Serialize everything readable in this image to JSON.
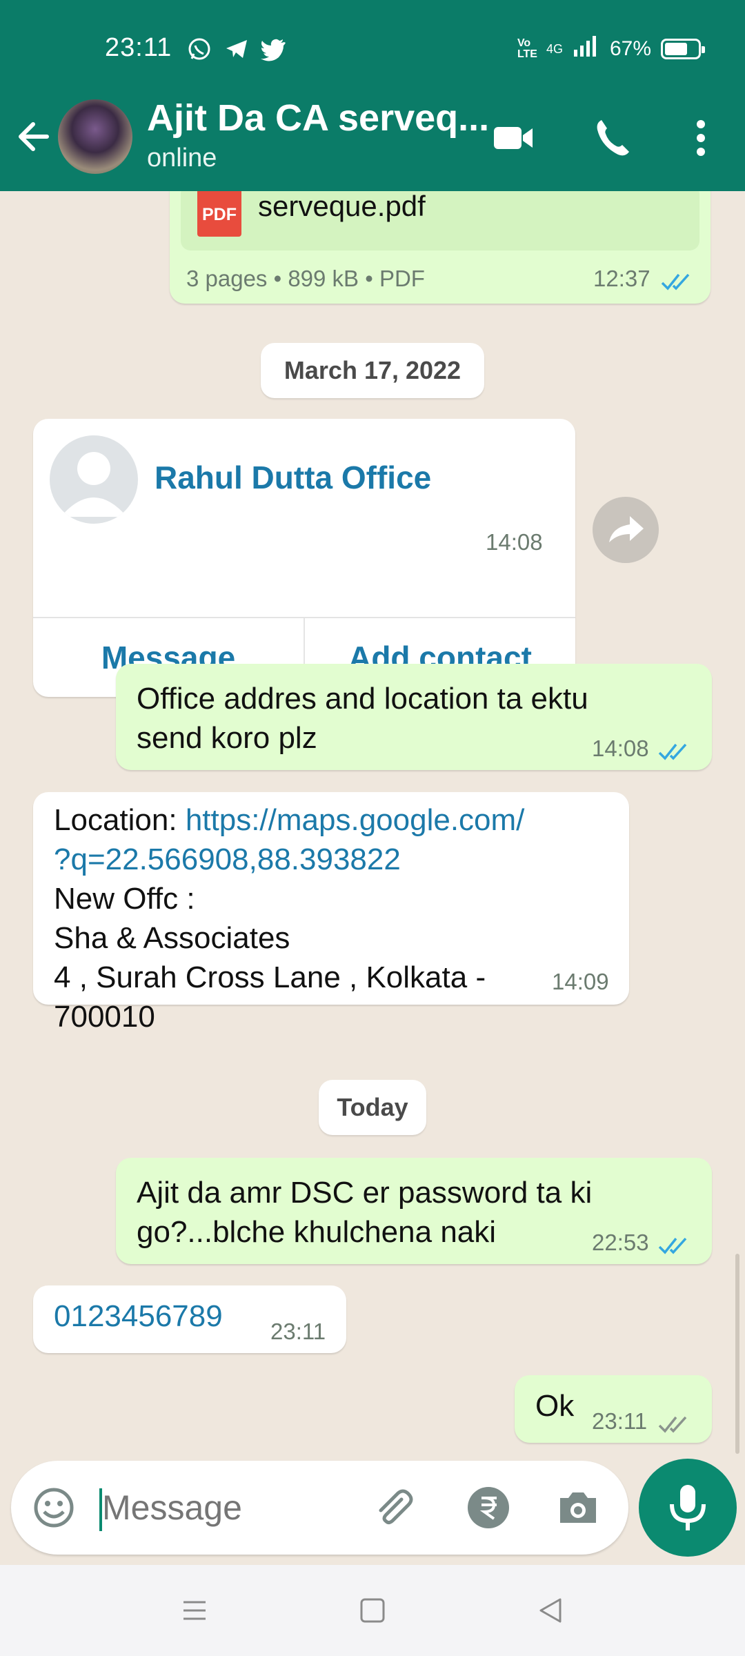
{
  "status_bar": {
    "time": "23:11",
    "network_label": "4G",
    "volte_label": "Vo LTE",
    "battery_percent": "67%",
    "app_icons": [
      "whatsapp-icon",
      "telegram-icon",
      "twitter-icon"
    ]
  },
  "header": {
    "contact_name": "Ajit Da CA serveq...",
    "status": "online",
    "icons": [
      "back-arrow-icon",
      "video-call-icon",
      "phone-icon",
      "more-vertical-icon"
    ]
  },
  "messages": {
    "pdf": {
      "file_name": "serveque.pdf",
      "pdf_badge": "PDF",
      "details": "3 pages • 899 kB • PDF",
      "time": "12:37"
    },
    "date_chip_1": "March 17, 2022",
    "contact_card": {
      "name": "Rahul Dutta Office",
      "time": "14:08",
      "message_button": "Message",
      "add_contact_button": "Add contact"
    },
    "msg_office": {
      "line1": "Office addres and location ta ektu",
      "line2": "send koro plz",
      "time": "14:08"
    },
    "msg_location": {
      "label": "Location: ",
      "link_line1": "https://maps.google.com/",
      "link_line2": "?q=22.566908,88.393822",
      "line3": "New Offc :",
      "line4": "Sha & Associates",
      "line5": "4 , Surah Cross Lane , Kolkata -",
      "line6": "700010",
      "time": "14:09"
    },
    "date_chip_2": "Today",
    "msg_dsc": {
      "line1": "Ajit da amr DSC er password ta ki",
      "line2": "go?...blche khulchena naki",
      "time": "22:53"
    },
    "msg_number": {
      "text": "0123456789",
      "time": "23:11"
    },
    "msg_ok": {
      "text": "Ok",
      "time": "23:11"
    }
  },
  "composer": {
    "placeholder": "Message"
  },
  "colors": {
    "header": "#0b7c68",
    "outgoing_bubble": "#e2fdd0",
    "incoming_bubble": "#ffffff",
    "chat_background": "#efe7dd",
    "link": "#1b79a9",
    "read_ticks": "#34a7e0"
  }
}
